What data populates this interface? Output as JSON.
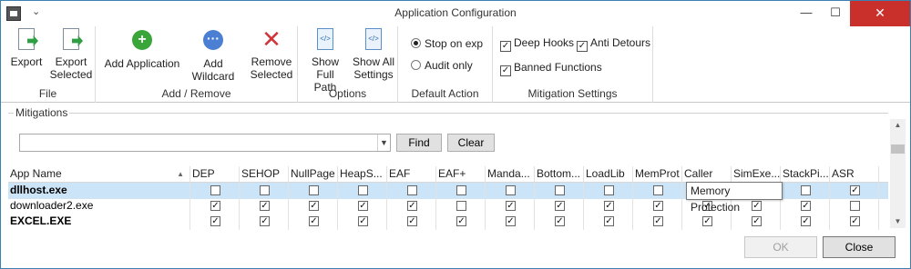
{
  "window": {
    "title": "Application Configuration",
    "minimize": "—",
    "maximize": "☐",
    "close": "✕",
    "qa_chevron": "⌄"
  },
  "ribbon": {
    "file": {
      "label": "File",
      "export": "Export",
      "export_selected_1": "Export",
      "export_selected_2": "Selected"
    },
    "add_remove": {
      "label": "Add / Remove",
      "add_application": "Add Application",
      "add_wildcard": "Add Wildcard",
      "remove_1": "Remove",
      "remove_2": "Selected"
    },
    "options": {
      "label": "Options",
      "show_full_path_1": "Show Full",
      "show_full_path_2": "Path",
      "show_all_settings_1": "Show All",
      "show_all_settings_2": "Settings"
    },
    "default_action": {
      "label": "Default Action",
      "stop_on_exp": "Stop on exp",
      "audit_only": "Audit only",
      "selected": "stop_on_exp"
    },
    "mitigation_settings": {
      "label": "Mitigation Settings",
      "deep_hooks": "Deep Hooks",
      "anti_detours": "Anti Detours",
      "banned_functions": "Banned Functions",
      "deep_hooks_checked": true,
      "anti_detours_checked": true,
      "banned_functions_checked": true
    }
  },
  "mitigations": {
    "group_label": "Mitigations",
    "search_value": "",
    "find": "Find",
    "clear": "Clear"
  },
  "grid": {
    "columns": [
      "App Name",
      "DEP",
      "SEHOP",
      "NullPage",
      "HeapS...",
      "EAF",
      "EAF+",
      "Manda...",
      "Bottom...",
      "LoadLib",
      "MemProt",
      "Caller",
      "SimExe...",
      "StackPi...",
      "ASR"
    ],
    "rows": [
      {
        "name": "dllhost.exe",
        "bold": true,
        "selected": true,
        "checks": [
          false,
          false,
          false,
          false,
          false,
          false,
          false,
          false,
          false,
          false,
          false,
          false,
          false,
          true
        ]
      },
      {
        "name": "downloader2.exe",
        "bold": false,
        "selected": false,
        "checks": [
          true,
          true,
          true,
          true,
          true,
          false,
          true,
          true,
          true,
          true,
          true,
          true,
          true,
          false
        ]
      },
      {
        "name": "EXCEL.EXE",
        "bold": true,
        "selected": false,
        "checks": [
          true,
          true,
          true,
          true,
          true,
          true,
          true,
          true,
          true,
          true,
          true,
          true,
          true,
          true
        ]
      }
    ]
  },
  "tooltip": "Memory Protection",
  "footer": {
    "ok": "OK",
    "close": "Close"
  },
  "colors": {
    "selection": "#cce4f7",
    "close_button": "#c9302c",
    "window_border": "#3c7fb1"
  }
}
